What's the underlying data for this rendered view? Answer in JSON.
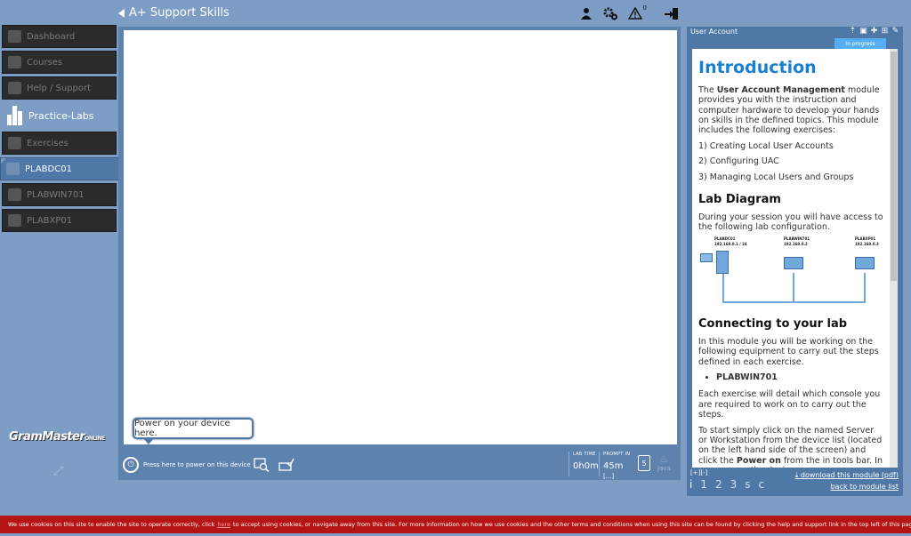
{
  "header": {
    "title": "A+ Support Skills",
    "alert_count": "0"
  },
  "sidebar": {
    "items": [
      {
        "label": "Dashboard",
        "icon": "home-icon"
      },
      {
        "label": "Courses",
        "icon": "graduation-cap-icon"
      },
      {
        "label": "Help / Support",
        "icon": "help-icon"
      },
      {
        "label": "Practice-Labs",
        "icon": "practice-labs-logo"
      },
      {
        "label": "Exercises",
        "icon": "graduation-cap-icon"
      },
      {
        "label": "PLABDC01",
        "icon": "monitor-icon"
      },
      {
        "label": "PLABWIN701",
        "icon": "monitor-icon"
      },
      {
        "label": "PLABXP01",
        "icon": "monitor-icon"
      }
    ],
    "brand": "GramMaster",
    "brand_suffix": "ONLINE"
  },
  "console": {
    "tooltip": "Power on your device here.",
    "power_label": "Press here to power on this device",
    "lab_time_label": "LAB TIME",
    "lab_time": "0h0m",
    "prompt_label": "PROMPT IN",
    "prompt_value": "45m",
    "prompt_extra": "[...]",
    "java_label": "Java"
  },
  "panel": {
    "title": "User Account",
    "status": "In progress",
    "heading_intro": "Introduction",
    "intro_prefix": "The ",
    "intro_bold": "User Account Management",
    "intro_rest": " module provides you with the instruction and computer hardware to develop your hands on skills in the defined topics. This module includes the following exercises:",
    "exercises": [
      "1) Creating Local User Accounts",
      "2) Configuring UAC",
      "3) Managing Local Users and Groups"
    ],
    "heading_diagram": "Lab Diagram",
    "diagram_text": "During your session you will have access to the following lab configuration.",
    "diagram_nodes": [
      {
        "name": "PLABDC01",
        "ip": "192.168.0.1 / 24"
      },
      {
        "name": "PLABWIN701",
        "ip": "192.168.0.2"
      },
      {
        "name": "PLABXP01",
        "ip": "192.168.0.3"
      }
    ],
    "heading_connect": "Connecting to your lab",
    "connect_text": "In this module you will be working on the following equipment to carry out the steps defined in each exercise.",
    "equipment": [
      "PLABWIN701"
    ],
    "console_text": "Each exercise will detail which console you are required to work on to carry out the steps.",
    "start_prefix": "To start simply click on the named Server or Workstation from the device list (located on the left hand side of the screen) and click the ",
    "start_bold": "Power on",
    "start_rest": " from the in tools bar. In some cases the devices may power on automatically.",
    "expand": "[+][-]",
    "nav": [
      "i",
      "1",
      "2",
      "3",
      "s",
      "c"
    ],
    "download": "download this module (pdf)",
    "back": "back to module list"
  },
  "cookie": {
    "prefix": "We use cookies on this site to enable the site to operate correctly, click",
    "link": "here",
    "suffix": "to accept using cookies, or navigate away from this site. For more information on how we use cookies and the other terms and conditions when using this site can be found by clicking the help and support link in the top left of this page."
  }
}
